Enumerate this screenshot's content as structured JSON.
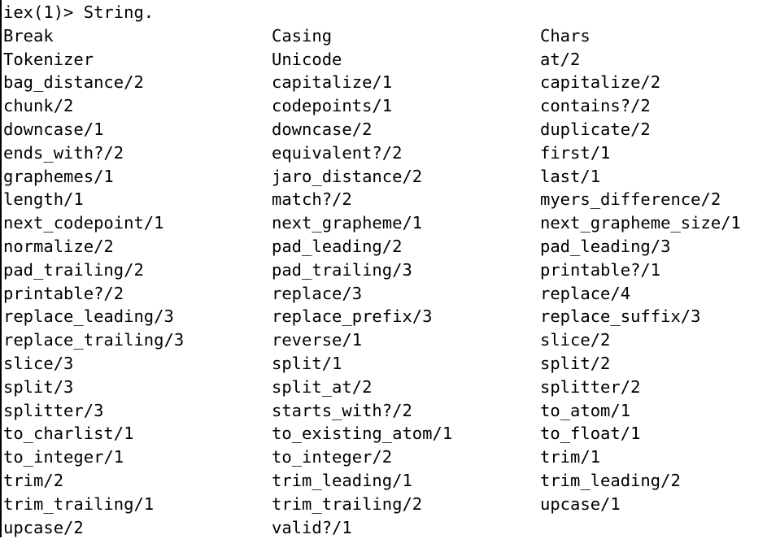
{
  "prompt": "iex(1)> String.",
  "completions": [
    [
      "Break",
      "Casing",
      "Chars"
    ],
    [
      "Tokenizer",
      "Unicode",
      "at/2"
    ],
    [
      "bag_distance/2",
      "capitalize/1",
      "capitalize/2"
    ],
    [
      "chunk/2",
      "codepoints/1",
      "contains?/2"
    ],
    [
      "downcase/1",
      "downcase/2",
      "duplicate/2"
    ],
    [
      "ends_with?/2",
      "equivalent?/2",
      "first/1"
    ],
    [
      "graphemes/1",
      "jaro_distance/2",
      "last/1"
    ],
    [
      "length/1",
      "match?/2",
      "myers_difference/2"
    ],
    [
      "next_codepoint/1",
      "next_grapheme/1",
      "next_grapheme_size/1"
    ],
    [
      "normalize/2",
      "pad_leading/2",
      "pad_leading/3"
    ],
    [
      "pad_trailing/2",
      "pad_trailing/3",
      "printable?/1"
    ],
    [
      "printable?/2",
      "replace/3",
      "replace/4"
    ],
    [
      "replace_leading/3",
      "replace_prefix/3",
      "replace_suffix/3"
    ],
    [
      "replace_trailing/3",
      "reverse/1",
      "slice/2"
    ],
    [
      "slice/3",
      "split/1",
      "split/2"
    ],
    [
      "split/3",
      "split_at/2",
      "splitter/2"
    ],
    [
      "splitter/3",
      "starts_with?/2",
      "to_atom/1"
    ],
    [
      "to_charlist/1",
      "to_existing_atom/1",
      "to_float/1"
    ],
    [
      "to_integer/1",
      "to_integer/2",
      "trim/1"
    ],
    [
      "trim/2",
      "trim_leading/1",
      "trim_leading/2"
    ],
    [
      "trim_trailing/1",
      "trim_trailing/2",
      "upcase/1"
    ],
    [
      "upcase/2",
      "valid?/1",
      ""
    ]
  ]
}
